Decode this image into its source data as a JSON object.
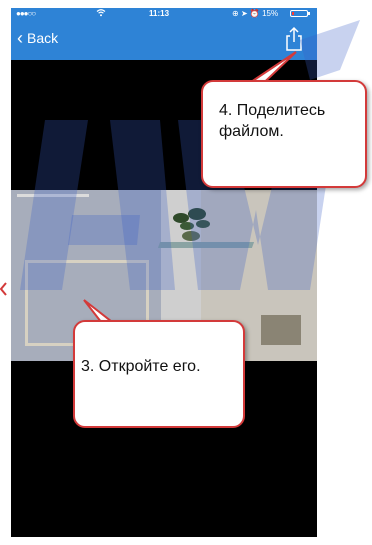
{
  "status_bar": {
    "signal": "●●●○○",
    "time": "11:13",
    "battery": "15%",
    "battery_level": 0.15
  },
  "nav": {
    "back_label": "Back"
  },
  "icons": {
    "back": "chevron-left-icon",
    "share": "share-icon",
    "wifi": "wifi-icon"
  },
  "colors": {
    "nav_bar": "#2e83d6",
    "bubble_border": "#d33a3a",
    "phone_background": "#000000"
  },
  "annotations": {
    "step4": "4. Поделитесь\nфайлом.",
    "step3": "3. Откройте его."
  }
}
